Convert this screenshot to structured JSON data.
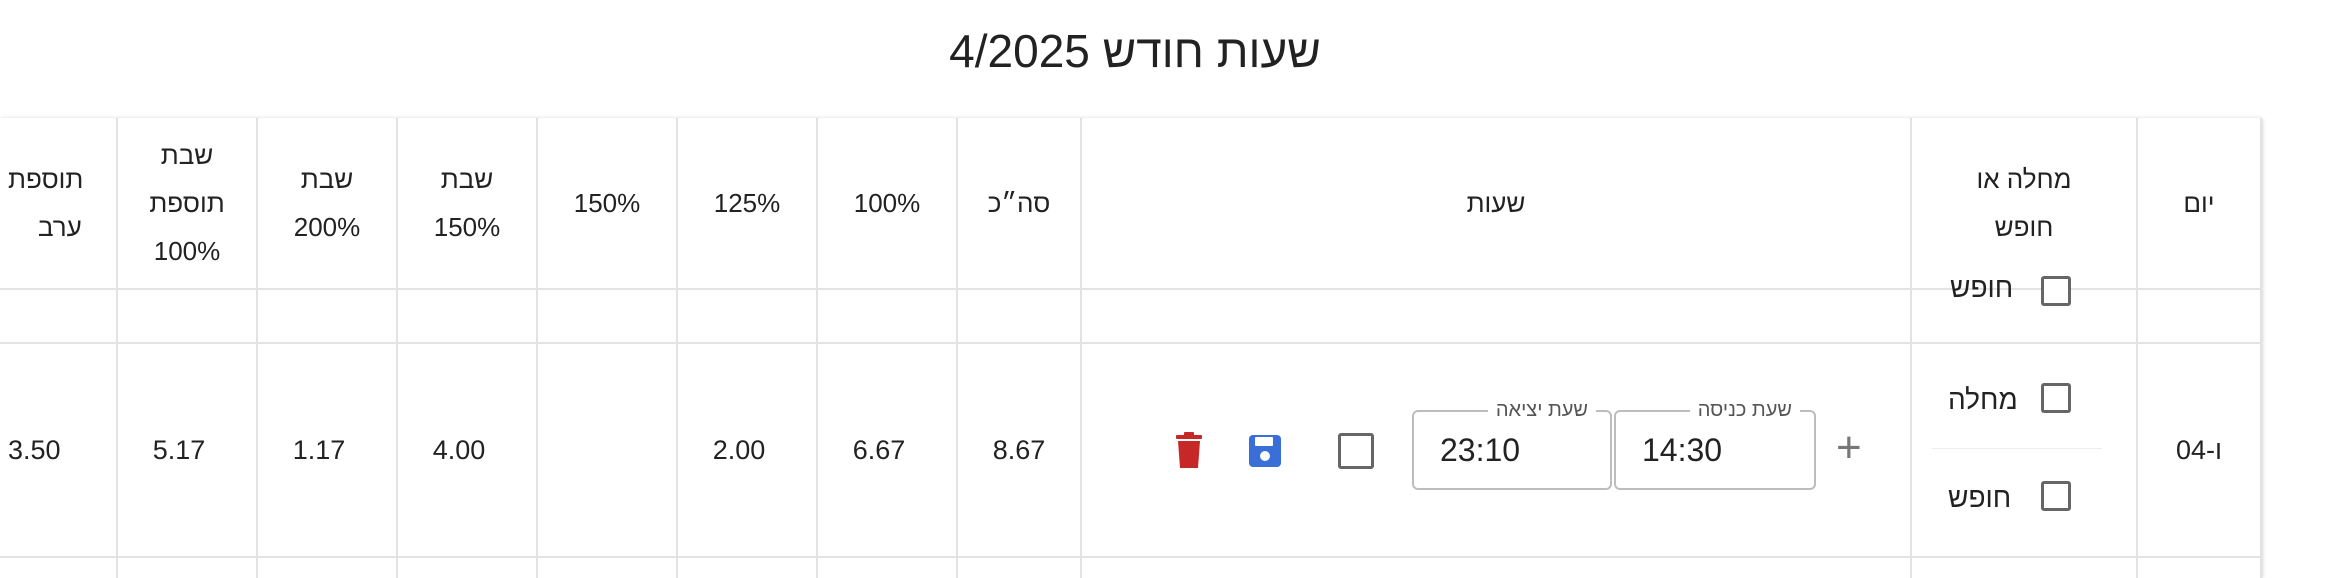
{
  "title": "שעות חודש 4/2025",
  "headers": {
    "day": "יום",
    "sick_or_vacation_line1": "מחלה או",
    "sick_or_vacation_line2": "חופש",
    "hours": "שעות",
    "total": "סה״כ",
    "p100": "100%",
    "p125": "125%",
    "p150": "150%",
    "shabbat150_line1": "שבת",
    "shabbat150_line2": "150%",
    "shabbat200_line1": "שבת",
    "shabbat200_line2": "200%",
    "shabbat_extra_line1": "שבת",
    "shabbat_extra_line2": "תוספת",
    "shabbat_extra_line3": "100%",
    "evening_extra_line1": "תוספת",
    "evening_extra_line2": "ערב"
  },
  "prev_row": {
    "vacation_label": "חופש"
  },
  "row": {
    "day": "ו-04",
    "sick_label": "מחלה",
    "vacation_label": "חופש",
    "entry_label": "שעת כניסה",
    "entry_value": "14:30",
    "exit_label": "שעת יציאה",
    "exit_value": "23:10",
    "total": "8.67",
    "p100": "6.67",
    "p125": "2.00",
    "p150": "",
    "shabbat150": "4.00",
    "shabbat200": "1.17",
    "shabbat_extra": "5.17",
    "evening_extra": "3.50"
  },
  "icons": {
    "delete": "trash-icon",
    "save": "floppy-disk-icon",
    "add": "plus-icon",
    "delete_color": "#c62828",
    "save_color": "#3a6fd8"
  }
}
